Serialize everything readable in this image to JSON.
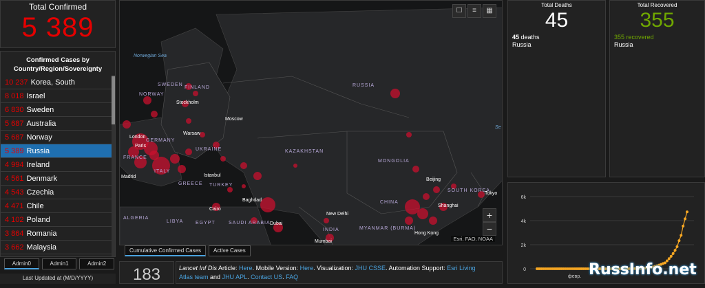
{
  "total_confirmed": {
    "label": "Total Confirmed",
    "value": "5 389"
  },
  "list": {
    "header_line1": "Confirmed Cases by",
    "header_line2": "Country/Region/Sovereignty",
    "items": [
      {
        "count": "10 237",
        "name": "Korea, South"
      },
      {
        "count": "8 018",
        "name": "Israel"
      },
      {
        "count": "6 830",
        "name": "Sweden"
      },
      {
        "count": "5 687",
        "name": "Australia"
      },
      {
        "count": "5 687",
        "name": "Norway"
      },
      {
        "count": "5 389",
        "name": "Russia"
      },
      {
        "count": "4 994",
        "name": "Ireland"
      },
      {
        "count": "4 561",
        "name": "Denmark"
      },
      {
        "count": "4 543",
        "name": "Czechia"
      },
      {
        "count": "4 471",
        "name": "Chile"
      },
      {
        "count": "4 102",
        "name": "Poland"
      },
      {
        "count": "3 864",
        "name": "Romania"
      },
      {
        "count": "3 662",
        "name": "Malaysia"
      }
    ]
  },
  "left_tabs": [
    "Admin0",
    "Admin1",
    "Admin2"
  ],
  "last_updated": "Last Updated at (M/D/YYYY)",
  "map": {
    "labels_country": [
      "NORWAY",
      "SWEDEN",
      "FINLAND",
      "RUSSIA",
      "UKRAINE",
      "KAZAKHSTAN",
      "MONGOLIA",
      "TURKEY",
      "CHINA",
      "INDIA",
      "SAUDI ARABIA",
      "EGYPT",
      "LIBYA",
      "ALGERIA",
      "SOUTH KOREA",
      "FRANCE",
      "GERMANY",
      "ITALY",
      "GREECE",
      "MYANMAR (BURMA)"
    ],
    "labels_city": [
      "Stockholm",
      "Moscow",
      "Warsaw",
      "London",
      "Paris",
      "Madrid",
      "Istanbul",
      "Baghdad",
      "Cairo",
      "Dubai",
      "New Delhi",
      "Mumbai",
      "Beijing",
      "Shanghai",
      "Tokyo",
      "Hong Kong"
    ],
    "labels_sea": [
      "Norwegian Sea",
      "Se"
    ],
    "tools": [
      "bookmark-icon",
      "list-icon",
      "grid-icon"
    ],
    "zoom_in": "+",
    "zoom_out": "−",
    "attribution": "Esri, FAO, NOAA"
  },
  "map_tabs": [
    "Cumulative Confirmed Cases",
    "Active Cases"
  ],
  "countries_count": "183",
  "news": {
    "l1_italic": "Lancet Inf Dis",
    "l1_a": " Article: ",
    "here1": "Here",
    "l1_b": ". Mobile Version: ",
    "here2": "Here",
    "l1_c": ". Visualization: ",
    "jhu_csse": "JHU CSSE",
    "l1_d": ". Automation Support: ",
    "esri": "Esri Living",
    "atlas": "Atlas team",
    "and": " and ",
    "jhu_apl": "JHU APL",
    "dot": ". ",
    "contact": "Contact US",
    "faq": "FAQ"
  },
  "deaths": {
    "label": "Total Deaths",
    "value": "45",
    "sub_count": "45",
    "sub_unit": " deaths",
    "country": "Russia",
    "color": "#ffffff"
  },
  "recovered": {
    "label": "Total Recovered",
    "value": "355",
    "sub_text": "355 recovered",
    "country": "Russia",
    "color": "#70a800"
  },
  "chart_data": {
    "type": "line",
    "title": "",
    "xlabel": "",
    "ylabel": "",
    "x_tick_labels": [
      "февр."
    ],
    "y_tick_labels": [
      "0",
      "2k",
      "4k",
      "6k"
    ],
    "ylim": [
      0,
      6000
    ],
    "series": [
      {
        "values": [
          0,
          0,
          0,
          0,
          0,
          0,
          0,
          0,
          0,
          0,
          0,
          0,
          0,
          0,
          0,
          0,
          0,
          0,
          0,
          0,
          0,
          0,
          0,
          0,
          0,
          0,
          0,
          0,
          0,
          0,
          0,
          0,
          0,
          0,
          0,
          0,
          0,
          0,
          0,
          0,
          0,
          0,
          2,
          2,
          3,
          3,
          5,
          7,
          10,
          14,
          17,
          20,
          28,
          45,
          59,
          63,
          90,
          114,
          147,
          199,
          253,
          306,
          367,
          438,
          495,
          658,
          840,
          1036,
          1264,
          1534,
          1836,
          2337,
          2777,
          3548,
          4149,
          4731
        ]
      }
    ],
    "color": "#f5a623"
  },
  "watermark": "RussInfo.net"
}
